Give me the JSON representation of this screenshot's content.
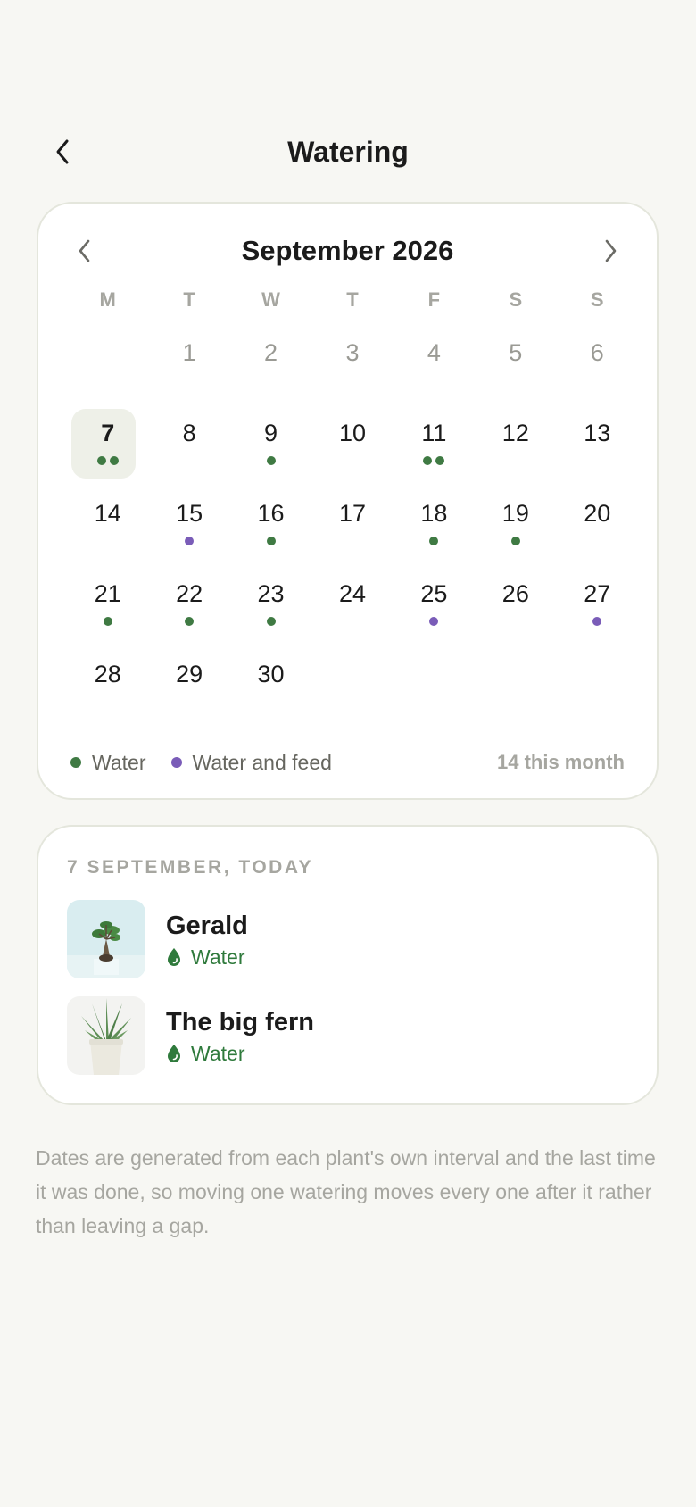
{
  "header": {
    "title": "Watering",
    "back_icon": "chevron-left-icon"
  },
  "calendar": {
    "month_label": "September 2026",
    "prev_icon": "chevron-left-icon",
    "next_icon": "chevron-right-icon",
    "weekdays": [
      "M",
      "T",
      "W",
      "T",
      "F",
      "S",
      "S"
    ],
    "days": [
      {
        "d": "",
        "dots": []
      },
      {
        "d": "1",
        "muted": true,
        "dots": []
      },
      {
        "d": "2",
        "muted": true,
        "dots": []
      },
      {
        "d": "3",
        "muted": true,
        "dots": []
      },
      {
        "d": "4",
        "muted": true,
        "dots": []
      },
      {
        "d": "5",
        "muted": true,
        "dots": []
      },
      {
        "d": "6",
        "muted": true,
        "dots": []
      },
      {
        "d": "7",
        "today": true,
        "dots": [
          "water",
          "water"
        ]
      },
      {
        "d": "8",
        "dots": []
      },
      {
        "d": "9",
        "dots": [
          "water"
        ]
      },
      {
        "d": "10",
        "dots": []
      },
      {
        "d": "11",
        "dots": [
          "water",
          "water"
        ]
      },
      {
        "d": "12",
        "dots": []
      },
      {
        "d": "13",
        "dots": []
      },
      {
        "d": "14",
        "dots": []
      },
      {
        "d": "15",
        "dots": [
          "feed"
        ]
      },
      {
        "d": "16",
        "dots": [
          "water"
        ]
      },
      {
        "d": "17",
        "dots": []
      },
      {
        "d": "18",
        "dots": [
          "water"
        ]
      },
      {
        "d": "19",
        "dots": [
          "water"
        ]
      },
      {
        "d": "20",
        "dots": []
      },
      {
        "d": "21",
        "dots": [
          "water"
        ]
      },
      {
        "d": "22",
        "dots": [
          "water"
        ]
      },
      {
        "d": "23",
        "dots": [
          "water"
        ]
      },
      {
        "d": "24",
        "dots": []
      },
      {
        "d": "25",
        "dots": [
          "feed"
        ]
      },
      {
        "d": "26",
        "dots": []
      },
      {
        "d": "27",
        "dots": [
          "feed"
        ]
      },
      {
        "d": "28",
        "dots": []
      },
      {
        "d": "29",
        "dots": []
      },
      {
        "d": "30",
        "dots": []
      }
    ],
    "legend": [
      {
        "label": "Water",
        "type": "water"
      },
      {
        "label": "Water and feed",
        "type": "feed"
      }
    ],
    "count_label": "14 this month"
  },
  "colors": {
    "water": "#3f7a43",
    "feed": "#7a5cb8"
  },
  "schedule": {
    "section_label": "7 SEPTEMBER, TODAY",
    "plants": [
      {
        "name": "Gerald",
        "task": "Water",
        "task_icon": "droplet-icon",
        "thumb": "bonsai-photo"
      },
      {
        "name": "The big fern",
        "task": "Water",
        "task_icon": "droplet-icon",
        "thumb": "succulent-photo"
      }
    ]
  },
  "footnote": "Dates are generated from each plant's own interval and the last time it was done, so moving one watering moves every one after it rather than leaving a gap."
}
